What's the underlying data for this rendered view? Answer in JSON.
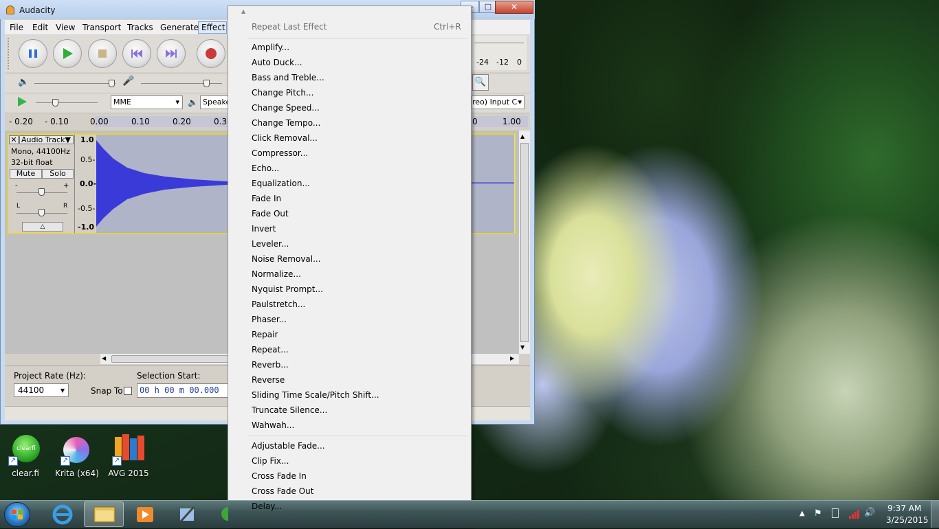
{
  "window": {
    "title": "Audacity"
  },
  "menubar": [
    "File",
    "Edit",
    "View",
    "Transport",
    "Tracks",
    "Generate",
    "Effect"
  ],
  "meter_labels": [
    "-24",
    "-12",
    "0"
  ],
  "device": {
    "host": "MME",
    "output": "Speake",
    "input": "reo) Input C"
  },
  "ruler": [
    "- 0.20",
    "- 0.10",
    "0.00",
    "0.10",
    "0.20",
    "0.30",
    "0",
    "1.00"
  ],
  "track": {
    "name": "Audio Track",
    "info1": "Mono, 44100Hz",
    "info2": "32-bit float",
    "mute": "Mute",
    "solo": "Solo",
    "gain_min": "-",
    "gain_max": "+",
    "pan_left": "L",
    "pan_right": "R",
    "scale": [
      "1.0",
      "0.5-",
      "0.0-",
      "-0.5-",
      "-1.0"
    ]
  },
  "selection_toolbar": {
    "project_rate_label": "Project Rate (Hz):",
    "project_rate": "44100",
    "snap_to": "Snap To",
    "selection_start": "Selection Start:",
    "time": "00 h 00 m 00.000"
  },
  "effect_menu": {
    "repeat_last": {
      "label": "Repeat Last Effect",
      "shortcut": "Ctrl+R"
    },
    "items": [
      "Amplify...",
      "Auto Duck...",
      "Bass and Treble...",
      "Change Pitch...",
      "Change Speed...",
      "Change Tempo...",
      "Click Removal...",
      "Compressor...",
      "Echo...",
      "Equalization...",
      "Fade In",
      "Fade Out",
      "Invert",
      "Leveler...",
      "Noise Removal...",
      "Normalize...",
      "Nyquist Prompt...",
      "Paulstretch...",
      "Phaser...",
      "Repair",
      "Repeat...",
      "Reverb...",
      "Reverse",
      "Sliding Time Scale/Pitch Shift...",
      "Truncate Silence...",
      "Wahwah..."
    ],
    "plugin_items": [
      "Adjustable Fade...",
      "Clip Fix...",
      "Cross Fade In",
      "Cross Fade Out",
      "Delay..."
    ]
  },
  "desktop_icons": [
    "clear.fi",
    "Krita (x64)",
    "AVG 2015"
  ],
  "desktop_icon_art": {
    "clearfi": "clearfi"
  },
  "taskbar": {
    "time": "9:37 AM",
    "date": "3/25/2015"
  },
  "colors": {
    "waveform": "#3a3ad8",
    "track_border": "#e6d23a",
    "menu_bg": "#f0f0f0"
  }
}
